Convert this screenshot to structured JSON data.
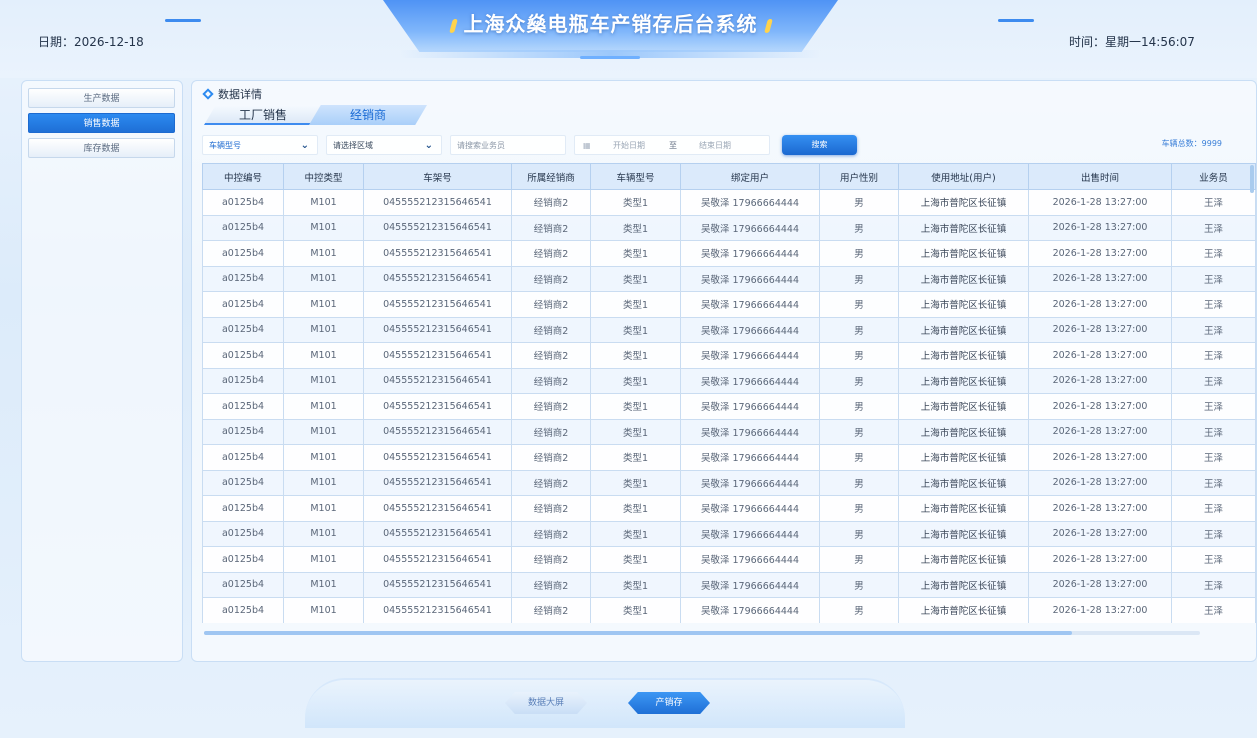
{
  "header": {
    "title": "上海众燊电瓶车产销存后台系统",
    "date": "日期：2026-12-18",
    "time": "时间：星期一14:56:07"
  },
  "sidebar": {
    "items": [
      {
        "label": "生产数据"
      },
      {
        "label": "销售数据"
      },
      {
        "label": "库存数据"
      }
    ]
  },
  "panel": {
    "title": "数据详情",
    "tabs": [
      {
        "label": "工厂销售"
      },
      {
        "label": "经销商"
      }
    ]
  },
  "filters": {
    "vehicle_model": "车辆型号",
    "region": "请选择区域",
    "salesperson_placeholder": "请搜索业务员",
    "start_date": "开始日期",
    "date_sep": "至",
    "end_date": "结束日期",
    "search_label": "搜索",
    "total": "车辆总数：9999"
  },
  "table": {
    "columns": [
      "中控编号",
      "中控类型",
      "车架号",
      "所属经销商",
      "车辆型号",
      "绑定用户",
      "用户性别",
      "使用地址(用户)",
      "出售时间",
      "业务员"
    ],
    "rows": [
      [
        "a0125b4",
        "M101",
        "045555212315646541",
        "经销商2",
        "类型1",
        "吴敬泽 17966664444",
        "男",
        "上海市普陀区长征镇",
        "2026-1-28  13:27:00",
        "王泽"
      ],
      [
        "a0125b4",
        "M101",
        "045555212315646541",
        "经销商2",
        "类型1",
        "吴敬泽 17966664444",
        "男",
        "上海市普陀区长征镇",
        "2026-1-28  13:27:00",
        "王泽"
      ],
      [
        "a0125b4",
        "M101",
        "045555212315646541",
        "经销商2",
        "类型1",
        "吴敬泽 17966664444",
        "男",
        "上海市普陀区长征镇",
        "2026-1-28  13:27:00",
        "王泽"
      ],
      [
        "a0125b4",
        "M101",
        "045555212315646541",
        "经销商2",
        "类型1",
        "吴敬泽 17966664444",
        "男",
        "上海市普陀区长征镇",
        "2026-1-28  13:27:00",
        "王泽"
      ],
      [
        "a0125b4",
        "M101",
        "045555212315646541",
        "经销商2",
        "类型1",
        "吴敬泽 17966664444",
        "男",
        "上海市普陀区长征镇",
        "2026-1-28  13:27:00",
        "王泽"
      ],
      [
        "a0125b4",
        "M101",
        "045555212315646541",
        "经销商2",
        "类型1",
        "吴敬泽 17966664444",
        "男",
        "上海市普陀区长征镇",
        "2026-1-28  13:27:00",
        "王泽"
      ],
      [
        "a0125b4",
        "M101",
        "045555212315646541",
        "经销商2",
        "类型1",
        "吴敬泽 17966664444",
        "男",
        "上海市普陀区长征镇",
        "2026-1-28  13:27:00",
        "王泽"
      ],
      [
        "a0125b4",
        "M101",
        "045555212315646541",
        "经销商2",
        "类型1",
        "吴敬泽 17966664444",
        "男",
        "上海市普陀区长征镇",
        "2026-1-28  13:27:00",
        "王泽"
      ],
      [
        "a0125b4",
        "M101",
        "045555212315646541",
        "经销商2",
        "类型1",
        "吴敬泽 17966664444",
        "男",
        "上海市普陀区长征镇",
        "2026-1-28  13:27:00",
        "王泽"
      ],
      [
        "a0125b4",
        "M101",
        "045555212315646541",
        "经销商2",
        "类型1",
        "吴敬泽 17966664444",
        "男",
        "上海市普陀区长征镇",
        "2026-1-28  13:27:00",
        "王泽"
      ],
      [
        "a0125b4",
        "M101",
        "045555212315646541",
        "经销商2",
        "类型1",
        "吴敬泽 17966664444",
        "男",
        "上海市普陀区长征镇",
        "2026-1-28  13:27:00",
        "王泽"
      ],
      [
        "a0125b4",
        "M101",
        "045555212315646541",
        "经销商2",
        "类型1",
        "吴敬泽 17966664444",
        "男",
        "上海市普陀区长征镇",
        "2026-1-28  13:27:00",
        "王泽"
      ],
      [
        "a0125b4",
        "M101",
        "045555212315646541",
        "经销商2",
        "类型1",
        "吴敬泽 17966664444",
        "男",
        "上海市普陀区长征镇",
        "2026-1-28  13:27:00",
        "王泽"
      ],
      [
        "a0125b4",
        "M101",
        "045555212315646541",
        "经销商2",
        "类型1",
        "吴敬泽 17966664444",
        "男",
        "上海市普陀区长征镇",
        "2026-1-28  13:27:00",
        "王泽"
      ],
      [
        "a0125b4",
        "M101",
        "045555212315646541",
        "经销商2",
        "类型1",
        "吴敬泽 17966664444",
        "男",
        "上海市普陀区长征镇",
        "2026-1-28  13:27:00",
        "王泽"
      ],
      [
        "a0125b4",
        "M101",
        "045555212315646541",
        "经销商2",
        "类型1",
        "吴敬泽 17966664444",
        "男",
        "上海市普陀区长征镇",
        "2026-1-28  13:27:00",
        "王泽"
      ],
      [
        "a0125b4",
        "M101",
        "045555212315646541",
        "经销商2",
        "类型1",
        "吴敬泽 17966664444",
        "男",
        "上海市普陀区长征镇",
        "2026-1-28  13:27:00",
        "王泽"
      ]
    ]
  },
  "bottom_nav": {
    "items": [
      {
        "label": "数据大屏"
      },
      {
        "label": "产销存"
      }
    ]
  },
  "icons": {
    "chevron": "chevron-down-icon",
    "calendar": "calendar-icon",
    "diamond": "diamond-icon"
  },
  "colors": {
    "accent": "#2c8af0",
    "title_bar": "#4f93f5",
    "header_row": "#dbeafb"
  }
}
